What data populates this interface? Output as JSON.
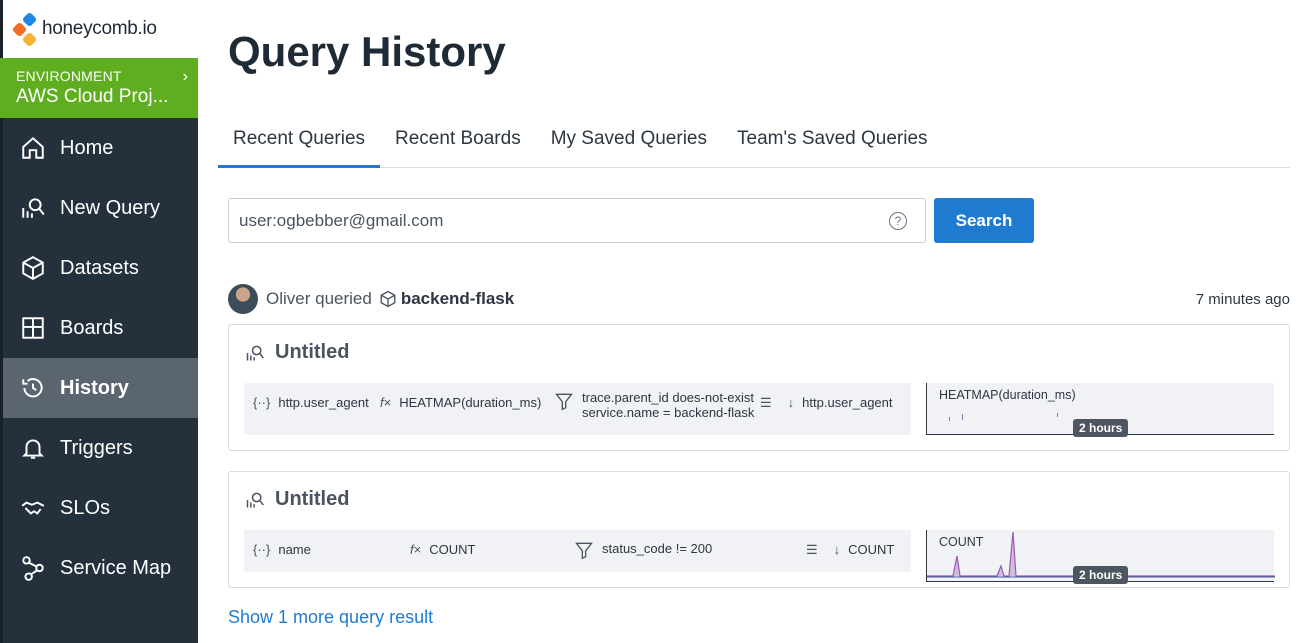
{
  "brand": {
    "name": "honeycomb.io"
  },
  "environment": {
    "label": "ENVIRONMENT",
    "name": "AWS Cloud Proj..."
  },
  "nav": [
    {
      "label": "Home",
      "icon": "home-icon"
    },
    {
      "label": "New Query",
      "icon": "new-query-icon"
    },
    {
      "label": "Datasets",
      "icon": "cube-icon"
    },
    {
      "label": "Boards",
      "icon": "boards-icon"
    },
    {
      "label": "History",
      "icon": "history-icon",
      "active": true
    },
    {
      "label": "Triggers",
      "icon": "bell-icon"
    },
    {
      "label": "SLOs",
      "icon": "handshake-icon"
    },
    {
      "label": "Service Map",
      "icon": "service-map-icon"
    }
  ],
  "page": {
    "title": "Query History"
  },
  "tabs": [
    "Recent Queries",
    "Recent Boards",
    "My Saved Queries",
    "Team's Saved Queries"
  ],
  "search": {
    "value": "user:ogbebber@gmail.com",
    "button": "Search"
  },
  "result": {
    "user": "Oliver queried",
    "dataset": "backend-flask",
    "time": "7 minutes ago"
  },
  "queries": [
    {
      "title": "Untitled",
      "group_by": "http.user_agent",
      "calculation": "HEATMAP(duration_ms)",
      "filter_line1": "trace.parent_id does-not-exist",
      "filter_line2": "service.name = backend-flask",
      "order": "http.user_agent",
      "viz_label": "HEATMAP(duration_ms)",
      "time_range": "2 hours"
    },
    {
      "title": "Untitled",
      "group_by": "name",
      "calculation": "COUNT",
      "filter_line1": "status_code != 200",
      "order": "COUNT",
      "viz_label": "COUNT",
      "time_range": "2 hours"
    }
  ],
  "more": {
    "label": "Show 1 more query result"
  },
  "colors": {
    "sidebar": "#24303c",
    "env": "#5fae1f",
    "accent": "#1f7bd0",
    "spark": "#9b59b6"
  }
}
